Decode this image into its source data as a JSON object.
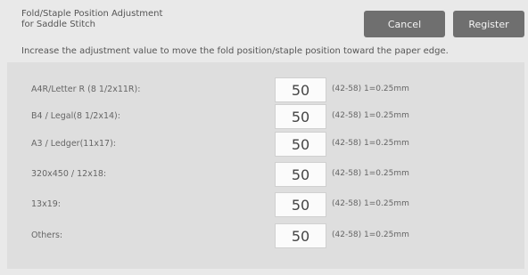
{
  "header": {
    "title_line1": "Fold/Staple Position Adjustment",
    "title_line2": "for Saddle Stitch",
    "cancel_label": "Cancel",
    "register_label": "Register"
  },
  "instruction": "Increase the adjustment value to move the fold position/staple position toward the paper edge.",
  "rows": [
    {
      "label": "A4R/Letter R (8 1/2x11R):",
      "value": "50",
      "range": "(42-58) 1=0.25mm"
    },
    {
      "label": "B4 / Legal(8 1/2x14):",
      "value": "50",
      "range": "(42-58) 1=0.25mm"
    },
    {
      "label": "A3 / Ledger(11x17):",
      "value": "50",
      "range": "(42-58) 1=0.25mm"
    },
    {
      "label": "320x450 / 12x18:",
      "value": "50",
      "range": "(42-58) 1=0.25mm"
    },
    {
      "label": "13x19:",
      "value": "50",
      "range": "(42-58) 1=0.25mm"
    },
    {
      "label": "Others:",
      "value": "50",
      "range": "(42-58) 1=0.25mm"
    }
  ],
  "colors": {
    "background": "#e9e9e9",
    "button": "#6f6f6f",
    "panel": "#dedede"
  }
}
